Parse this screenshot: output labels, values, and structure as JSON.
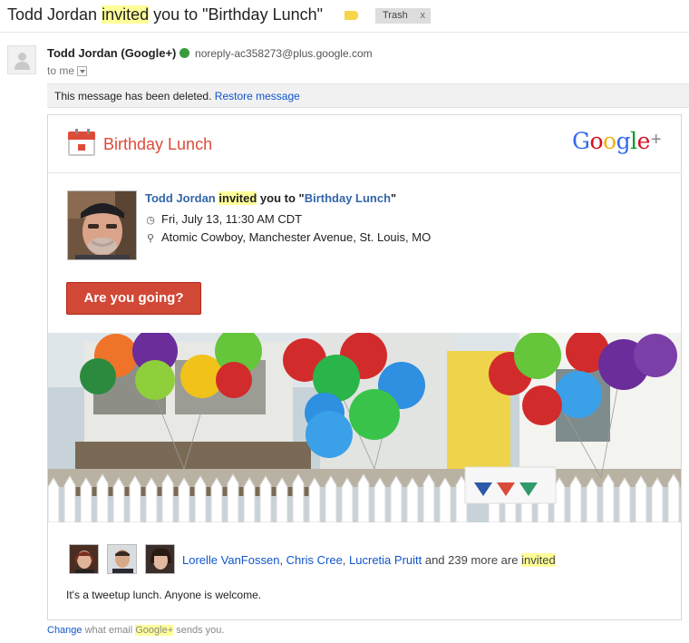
{
  "subject": {
    "prefix": "Todd Jordan ",
    "highlight": "invited",
    "suffix": " you to \"Birthday Lunch\""
  },
  "label_icon": "yellow-tag-icon",
  "trash_chip": {
    "label": "Trash",
    "close": "x"
  },
  "sender": {
    "name": "Todd Jordan (Google+)",
    "email": "noreply-ac358273@plus.google.com",
    "to": "to me"
  },
  "deleted_notice": {
    "text": "This message has been deleted. ",
    "restore_link": "Restore message"
  },
  "card": {
    "title": "Birthday Lunch",
    "logo": {
      "c1": "G",
      "c2": "o",
      "c3": "o",
      "c4": "g",
      "c5": "l",
      "c6": "e",
      "plus": "+"
    },
    "invite": {
      "name": "Todd Jordan",
      "highlight": "invited",
      "mid": " you to \"",
      "event": "Birthday Lunch",
      "end": "\""
    },
    "when": "Fri, July 13, 11:30 AM CDT",
    "where": "Atomic Cowboy, Manchester Avenue, St. Louis, MO",
    "rsvp_button": "Are you going?",
    "guests": {
      "names": [
        "Lorelle VanFossen",
        "Chris Cree",
        "Lucretia Pruitt"
      ],
      "sep": ", ",
      "more": " and 239 more are ",
      "highlight": "invited"
    },
    "description": "It's a tweetup lunch. Anyone is welcome."
  },
  "footer": {
    "change_link": "Change",
    "text_a": " what email ",
    "highlight": "Google+",
    "text_b": " sends you."
  },
  "colors": {
    "accent_red": "#dd4b39",
    "button_red": "#d14836",
    "link_blue": "#1155cc",
    "highlight_yellow": "#ffff99"
  }
}
